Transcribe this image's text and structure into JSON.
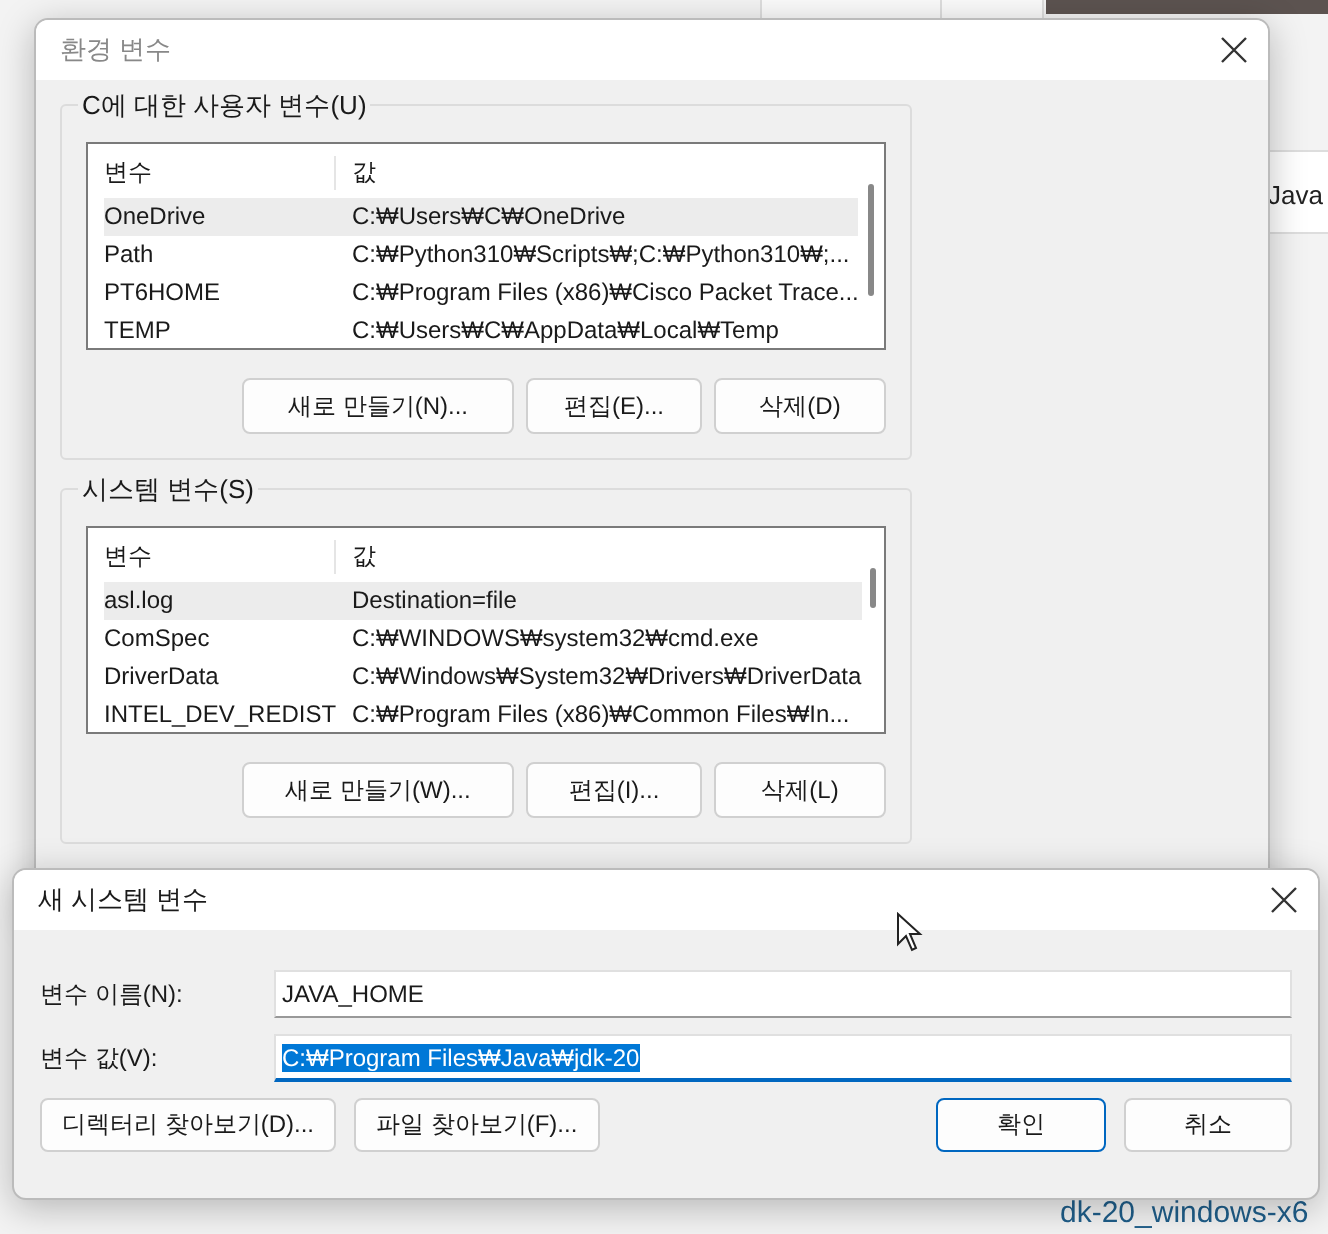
{
  "background": {
    "texts": [
      {
        "kind": "right",
        "text": "Java"
      },
      {
        "kind": "bottom",
        "text": "dk-20_windows-x6"
      }
    ]
  },
  "env_dialog": {
    "title": "환경 변수",
    "groups": [
      {
        "label": "C에 대한 사용자 변수(U)",
        "columns": [
          "변수",
          "값"
        ],
        "rows": [
          {
            "name": "OneDrive",
            "value": "C:₩Users₩C₩OneDrive",
            "selected": true
          },
          {
            "name": "Path",
            "value": "C:₩Python310₩Scripts₩;C:₩Python310₩;...",
            "selected": false
          },
          {
            "name": "PT6HOME",
            "value": "C:₩Program Files (x86)₩Cisco Packet Trace...",
            "selected": false
          },
          {
            "name": "TEMP",
            "value": "C:₩Users₩C₩AppData₩Local₩Temp",
            "selected": false
          }
        ],
        "buttons": [
          "새로 만들기(N)...",
          "편집(E)...",
          "삭제(D)"
        ]
      },
      {
        "label": "시스템 변수(S)",
        "columns": [
          "변수",
          "값"
        ],
        "rows": [
          {
            "name": "asl.log",
            "value": "Destination=file",
            "selected": true
          },
          {
            "name": "ComSpec",
            "value": "C:₩WINDOWS₩system32₩cmd.exe",
            "selected": false
          },
          {
            "name": "DriverData",
            "value": "C:₩Windows₩System32₩Drivers₩DriverData",
            "selected": false
          },
          {
            "name": "INTEL_DEV_REDIST",
            "value": "C:₩Program Files (x86)₩Common Files₩In...",
            "selected": false
          }
        ],
        "buttons": [
          "새로 만들기(W)...",
          "편집(I)...",
          "삭제(L)"
        ]
      }
    ]
  },
  "new_dialog": {
    "title": "새 시스템 변수",
    "fields": [
      {
        "label": "변수 이름(N):",
        "value": "JAVA_HOME",
        "focused": false,
        "highlighted": false
      },
      {
        "label": "변수 값(V):",
        "value": "C:₩Program Files₩Java₩jdk-20",
        "focused": true,
        "highlighted": true
      }
    ],
    "left_buttons": [
      "디렉터리 찾아보기(D)...",
      "파일 찾아보기(F)..."
    ],
    "right_buttons": [
      {
        "label": "확인",
        "default": true
      },
      {
        "label": "취소",
        "default": false
      }
    ]
  }
}
